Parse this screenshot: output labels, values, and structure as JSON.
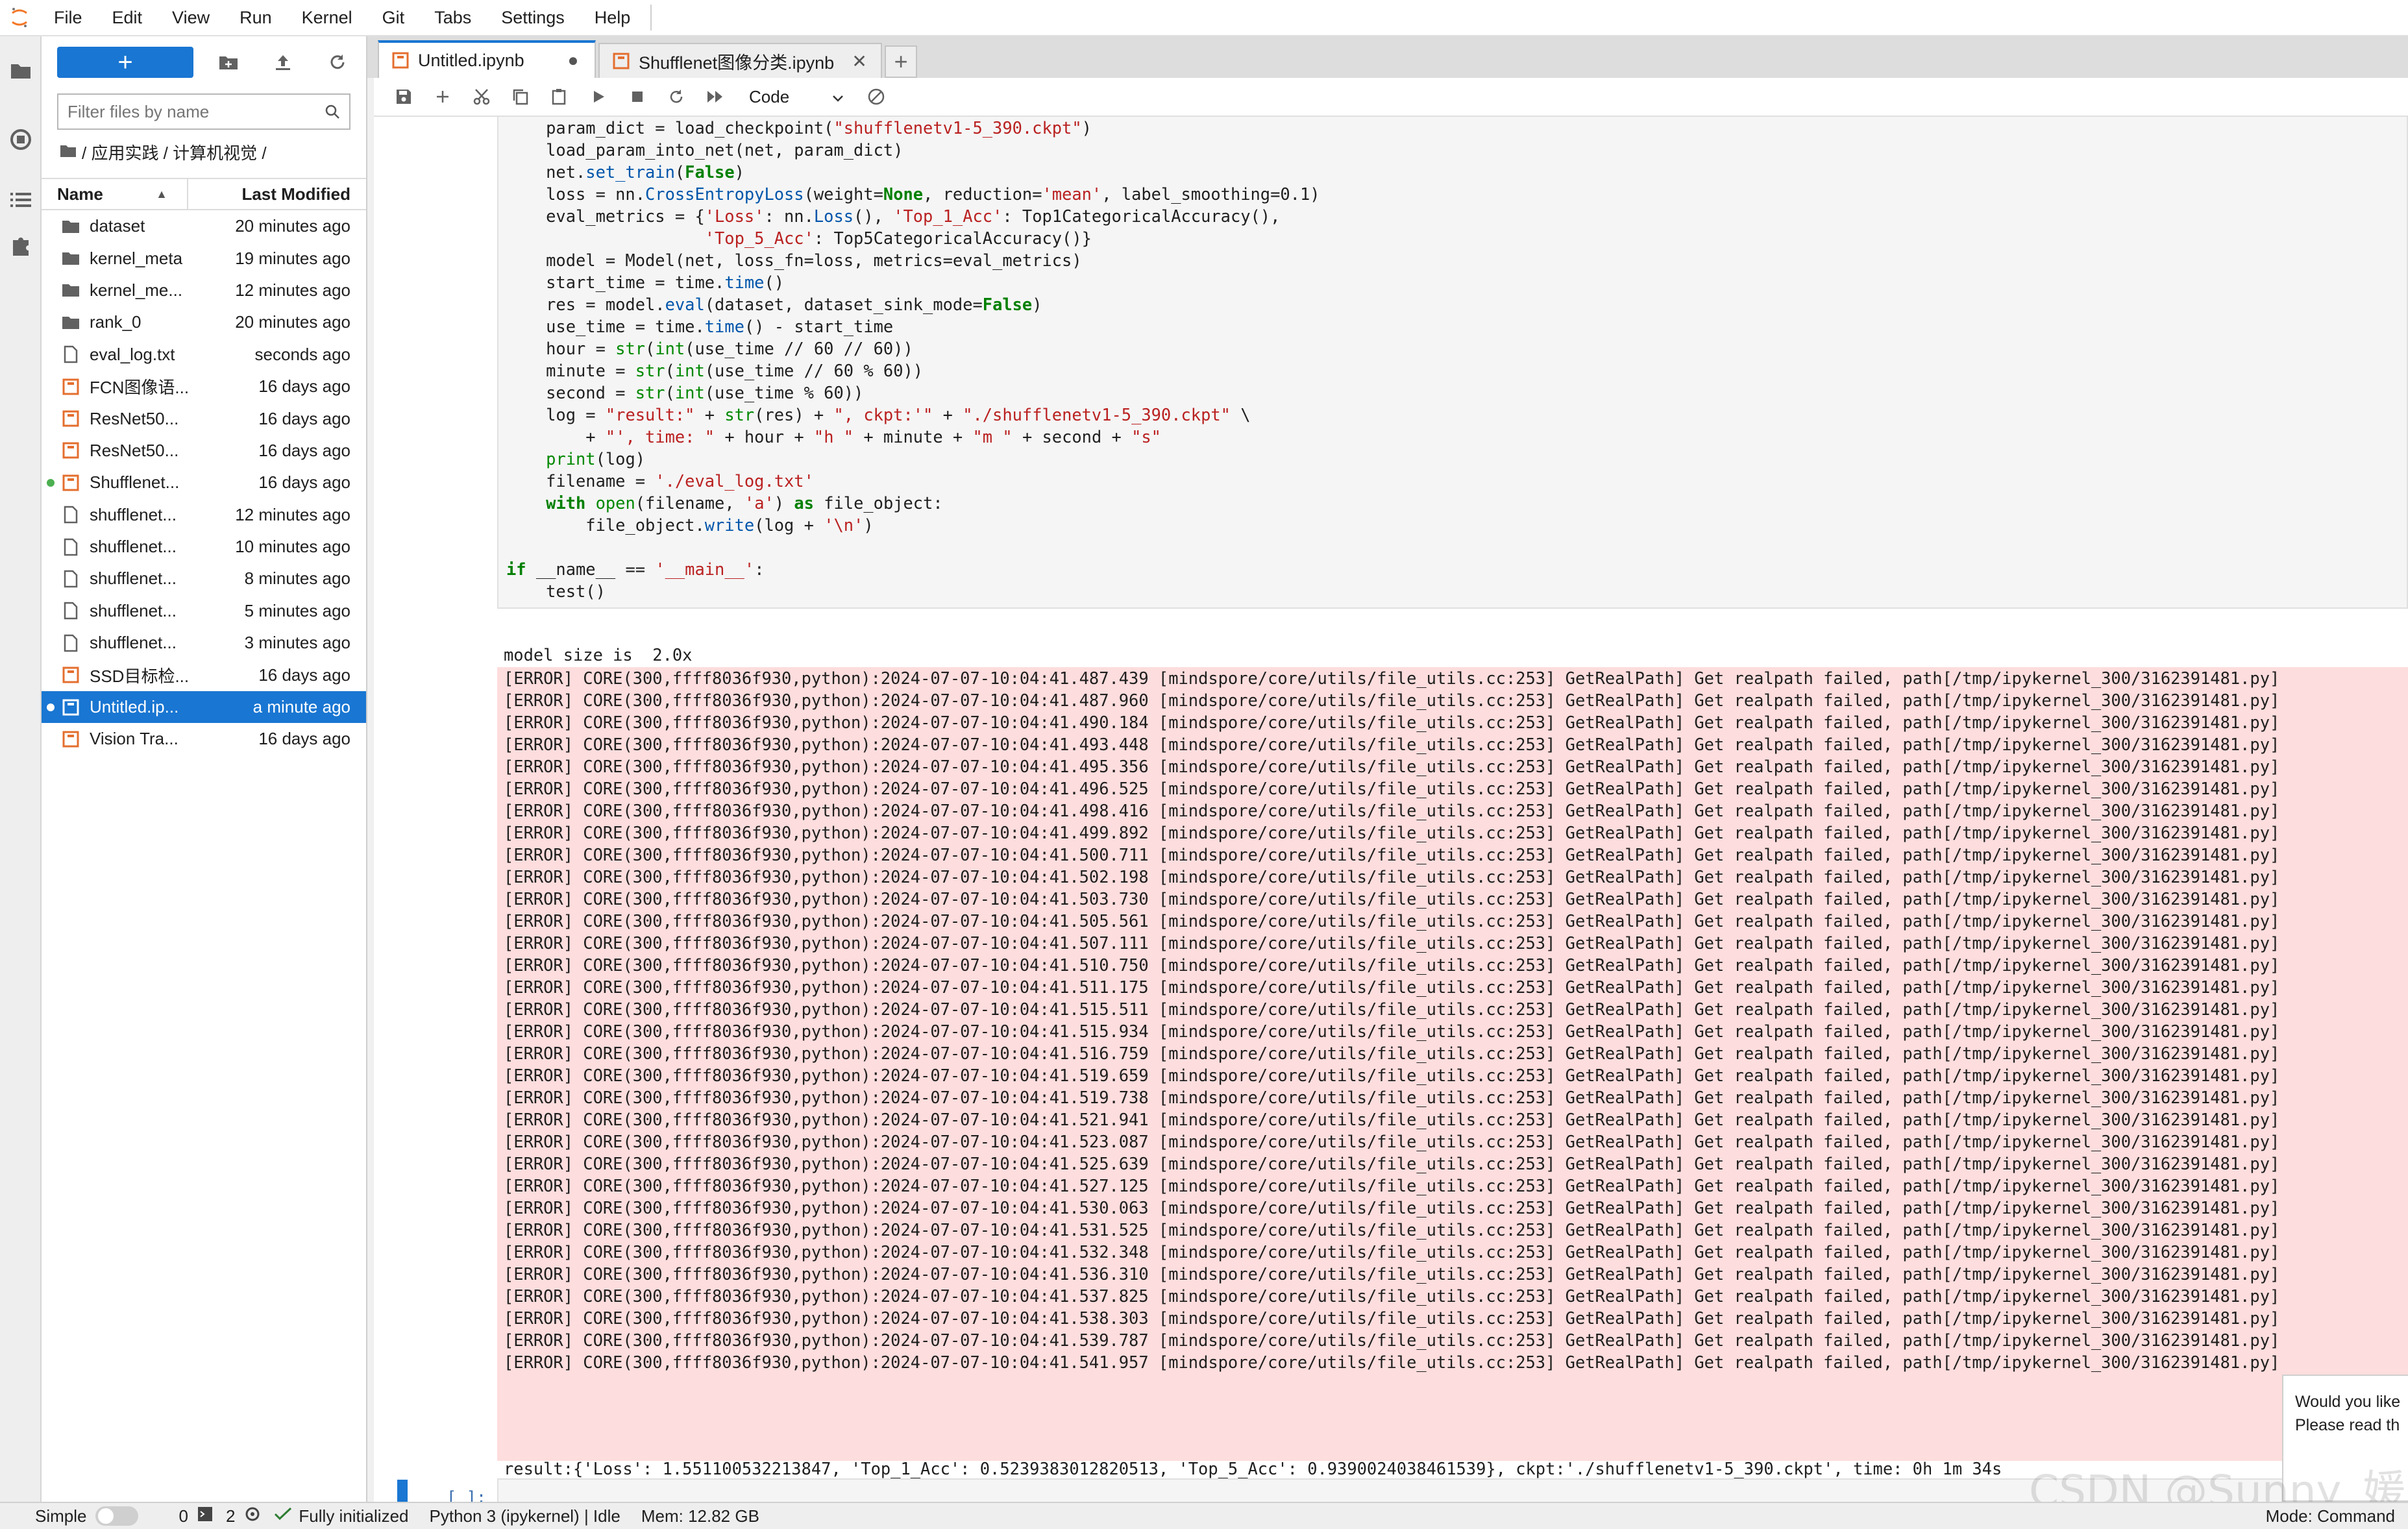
{
  "menubar": {
    "items": [
      "File",
      "Edit",
      "View",
      "Run",
      "Kernel",
      "Git",
      "Tabs",
      "Settings",
      "Help"
    ]
  },
  "filebrowser": {
    "new_label": "+",
    "search_placeholder": "Filter files by name",
    "breadcrumb": "/ 应用实践 / 计算机视觉 /",
    "col_name": "Name",
    "col_modified": "Last Modified",
    "files": [
      {
        "name": "dataset",
        "modified": "20 minutes ago",
        "icon": "folder-icon",
        "running": false
      },
      {
        "name": "kernel_meta",
        "modified": "19 minutes ago",
        "icon": "folder-icon",
        "running": false
      },
      {
        "name": "kernel_me...",
        "modified": "12 minutes ago",
        "icon": "folder-icon",
        "running": false
      },
      {
        "name": "rank_0",
        "modified": "20 minutes ago",
        "icon": "folder-icon",
        "running": false
      },
      {
        "name": "eval_log.txt",
        "modified": "seconds ago",
        "icon": "file-icon",
        "running": false
      },
      {
        "name": "FCN图像语...",
        "modified": "16 days ago",
        "icon": "notebook-icon",
        "running": false
      },
      {
        "name": "ResNet50...",
        "modified": "16 days ago",
        "icon": "notebook-icon",
        "running": false
      },
      {
        "name": "ResNet50...",
        "modified": "16 days ago",
        "icon": "notebook-icon",
        "running": false
      },
      {
        "name": "Shufflenet...",
        "modified": "16 days ago",
        "icon": "notebook-icon",
        "running": true
      },
      {
        "name": "shufflenet...",
        "modified": "12 minutes ago",
        "icon": "file-icon",
        "running": false
      },
      {
        "name": "shufflenet...",
        "modified": "10 minutes ago",
        "icon": "file-icon",
        "running": false
      },
      {
        "name": "shufflenet...",
        "modified": "8 minutes ago",
        "icon": "file-icon",
        "running": false
      },
      {
        "name": "shufflenet...",
        "modified": "5 minutes ago",
        "icon": "file-icon",
        "running": false
      },
      {
        "name": "shufflenet...",
        "modified": "3 minutes ago",
        "icon": "file-icon",
        "running": false
      },
      {
        "name": "SSD目标检...",
        "modified": "16 days ago",
        "icon": "notebook-icon",
        "running": false
      },
      {
        "name": "Untitled.ip...",
        "modified": "a minute ago",
        "icon": "notebook-icon",
        "running": true,
        "selected": true
      },
      {
        "name": "Vision Tra...",
        "modified": "16 days ago",
        "icon": "notebook-icon",
        "running": false
      }
    ]
  },
  "tabs": [
    {
      "label": "Untitled.ipynb",
      "close": "●",
      "active": true
    },
    {
      "label": "Shufflenet图像分类.ipynb",
      "close": "✕",
      "active": false
    }
  ],
  "tab_add": "+",
  "nb_toolbar": {
    "cell_type": "Code"
  },
  "code_lines": [
    "    param_dict = load_checkpoint(\"shufflenetv1-5_390.ckpt\")",
    "    load_param_into_net(net, param_dict)",
    "    net.set_train(False)",
    "    loss = nn.CrossEntropyLoss(weight=None, reduction='mean', label_smoothing=0.1)",
    "    eval_metrics = {'Loss': nn.Loss(), 'Top_1_Acc': Top1CategoricalAccuracy(),",
    "                    'Top_5_Acc': Top5CategoricalAccuracy()}",
    "    model = Model(net, loss_fn=loss, metrics=eval_metrics)",
    "    start_time = time.time()",
    "    res = model.eval(dataset, dataset_sink_mode=False)",
    "    use_time = time.time() - start_time",
    "    hour = str(int(use_time // 60 // 60))",
    "    minute = str(int(use_time // 60 % 60))",
    "    second = str(int(use_time % 60))",
    "    log = \"result:\" + str(res) + \", ckpt:'\" + \"./shufflenetv1-5_390.ckpt\" \\",
    "        + \"', time: \" + hour + \"h \" + minute + \"m \" + second + \"s\"",
    "    print(log)",
    "    filename = './eval_log.txt'",
    "    with open(filename, 'a') as file_object:",
    "        file_object.write(log + '\\n')",
    "",
    "if __name__ == '__main__':",
    "    test()"
  ],
  "output": {
    "model_size": "model size is  2.0x",
    "error_prefix": "[ERROR] CORE(300,ffff8036f930,python):2024-07-07-10:04:",
    "error_suffix": " [mindspore/core/utils/file_utils.cc:253] GetRealPath] Get realpath failed, path[/tmp/ipykernel_300/3162391481.py]",
    "error_times": [
      "41.487.439",
      "41.487.960",
      "41.490.184",
      "41.493.448",
      "41.495.356",
      "41.496.525",
      "41.498.416",
      "41.499.892",
      "41.500.711",
      "41.502.198",
      "41.503.730",
      "41.505.561",
      "41.507.111",
      "41.510.750",
      "41.511.175",
      "41.515.511",
      "41.515.934",
      "41.516.759",
      "41.519.659",
      "41.519.738",
      "41.521.941",
      "41.523.087",
      "41.525.639",
      "41.527.125",
      "41.530.063",
      "41.531.525",
      "41.532.348",
      "41.536.310",
      "41.537.825",
      "41.538.303",
      "41.539.787",
      "41.541.957"
    ],
    "result": "result:{'Loss': 1.551100532213847, 'Top_1_Acc': 0.5239383012820513, 'Top_5_Acc': 0.9390024038461539}, ckpt:'./shufflenetv1-5_390.ckpt', time: 0h 1m 34s"
  },
  "empty_cell_prompt": "[ ]:",
  "notification": {
    "line1": "Would you like",
    "line2": "Please read th"
  },
  "watermark": "CSDN @Sunny_媛",
  "statusbar": {
    "mode_label": "Simple",
    "terminals": "0",
    "kernels": "2",
    "git_status": "Fully initialized",
    "kernel": "Python 3 (ipykernel) | Idle",
    "memory": "Mem: 12.82 GB",
    "command_mode": "Mode: Command"
  },
  "colors": {
    "accent": "#1976d2",
    "stderr_bg": "#fddddd",
    "running_dot": "#4caf50",
    "notebook_icon": "#e46e2e"
  }
}
